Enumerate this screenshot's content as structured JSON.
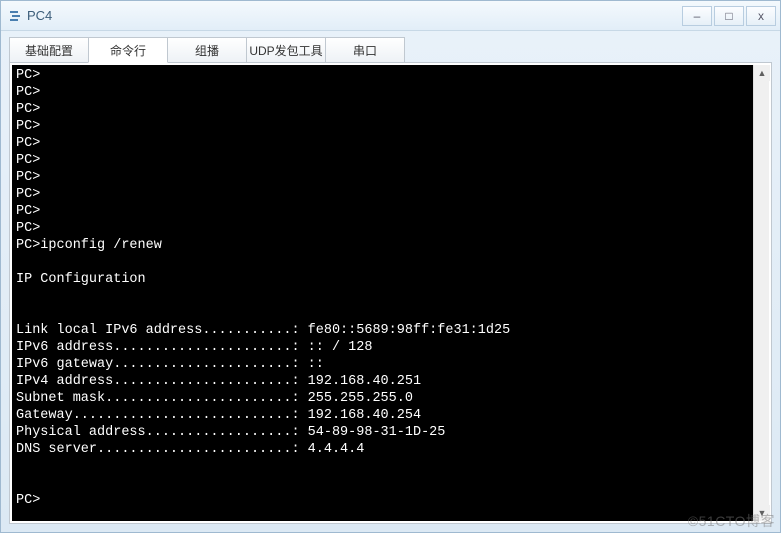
{
  "window": {
    "title": "PC4",
    "minimize": "–",
    "maximize": "□",
    "close": "x"
  },
  "tabs": [
    {
      "label": "基础配置",
      "active": false
    },
    {
      "label": "命令行",
      "active": true
    },
    {
      "label": "组播",
      "active": false
    },
    {
      "label": "UDP发包工具",
      "active": false
    },
    {
      "label": "串口",
      "active": false
    }
  ],
  "terminal": {
    "lines": [
      "PC>",
      "PC>",
      "PC>",
      "PC>",
      "PC>",
      "PC>",
      "PC>",
      "PC>",
      "PC>",
      "PC>",
      "PC>ipconfig /renew",
      "",
      "IP Configuration",
      "",
      "",
      "Link local IPv6 address...........: fe80::5689:98ff:fe31:1d25",
      "IPv6 address......................: :: / 128",
      "IPv6 gateway......................: ::",
      "IPv4 address......................: 192.168.40.251",
      "Subnet mask.......................: 255.255.255.0",
      "Gateway...........................: 192.168.40.254",
      "Physical address..................: 54-89-98-31-1D-25",
      "DNS server........................: 4.4.4.4",
      "",
      "",
      "PC>"
    ]
  },
  "watermark": "©51CTO博客"
}
